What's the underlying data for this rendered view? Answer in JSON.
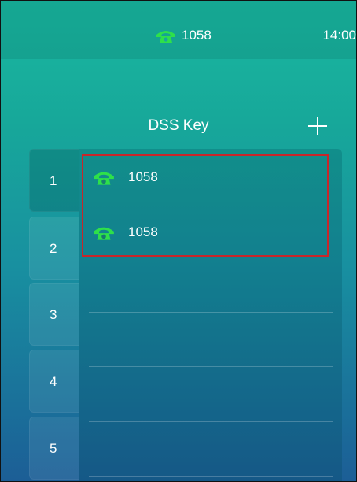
{
  "status": {
    "line_label": "1058",
    "time": "14:00"
  },
  "header": {
    "title": "DSS Key"
  },
  "keys": [
    "1",
    "2",
    "3",
    "4",
    "5"
  ],
  "entries": [
    {
      "label": "1058",
      "icon": "phone-icon"
    },
    {
      "label": "1058",
      "icon": "phone-icon"
    }
  ],
  "colors": {
    "phone_icon": "#2ee04a",
    "highlight": "#c8262a"
  }
}
